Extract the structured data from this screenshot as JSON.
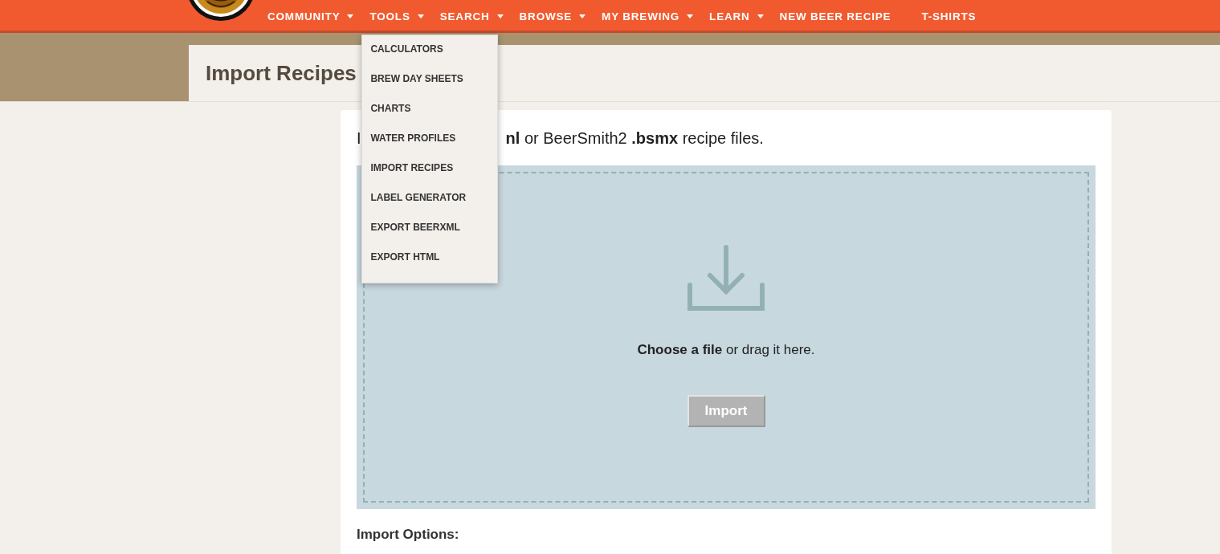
{
  "nav": [
    {
      "label": "COMMUNITY",
      "has_menu": true
    },
    {
      "label": "TOOLS",
      "has_menu": true,
      "menu": [
        "CALCULATORS",
        "BREW DAY SHEETS",
        "CHARTS",
        "WATER PROFILES",
        "IMPORT RECIPES",
        "LABEL GENERATOR",
        "EXPORT BEERXML",
        "EXPORT HTML"
      ]
    },
    {
      "label": "SEARCH",
      "has_menu": true
    },
    {
      "label": "BROWSE",
      "has_menu": true
    },
    {
      "label": "MY BREWING",
      "has_menu": true
    },
    {
      "label": "LEARN",
      "has_menu": true
    },
    {
      "label": "NEW BEER RECIPE",
      "has_menu": false
    },
    {
      "label": "T-SHIRTS",
      "has_menu": false
    }
  ],
  "page_title": "Import Recipes",
  "intro_start": "I",
  "intro_rest": "**nl** or BeerSmith2 **.bsmx** recipe files.",
  "dropzone": {
    "prompt": "**Choose a file** or drag it here.",
    "button": {
      "label": "Import",
      "disabled": true
    }
  },
  "options_heading": "Import Options:"
}
